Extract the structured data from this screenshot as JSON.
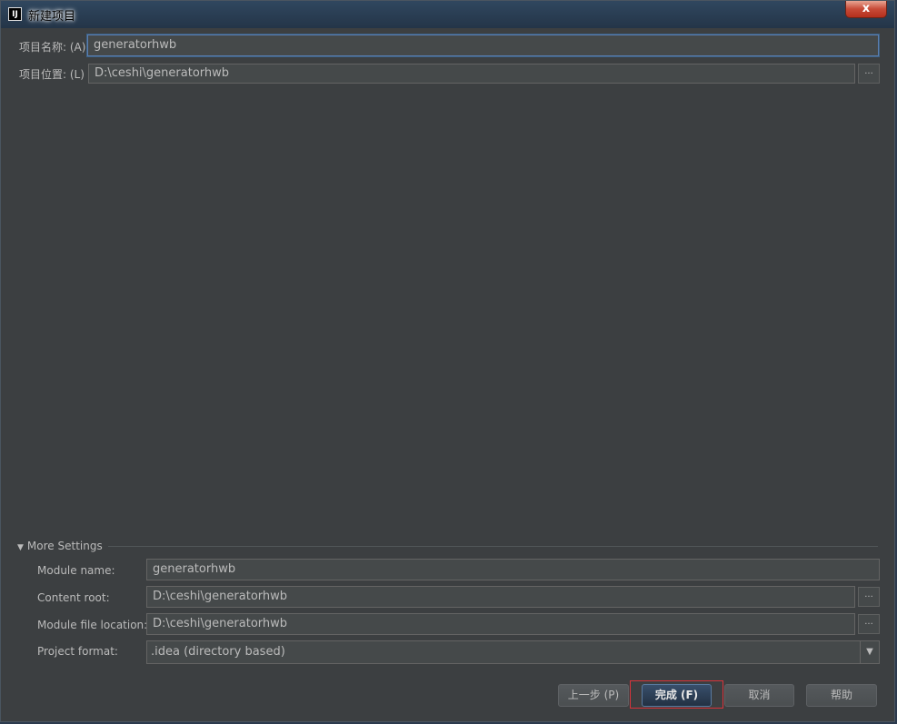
{
  "window": {
    "title": "新建项目",
    "icon_text": "IJ",
    "close_symbol": "x"
  },
  "project": {
    "name_label": "项目名称: (A)",
    "name_value": "generatorhwb",
    "location_label": "项目位置: (L)",
    "location_value": "D:\\ceshi\\generatorhwb",
    "browse_label": "..."
  },
  "more_settings": {
    "toggle_label": "More Settings",
    "module_name_label": "Module name:",
    "module_name_value": "generatorhwb",
    "content_root_label": "Content root:",
    "content_root_value": "D:\\ceshi\\generatorhwb",
    "module_file_label": "Module file location:",
    "module_file_value": "D:\\ceshi\\generatorhwb",
    "project_format_label": "Project format:",
    "project_format_value": ".idea (directory based)"
  },
  "footer": {
    "previous_label": "上一步 (P)",
    "finish_label": "完成 (F)",
    "cancel_label": "取消",
    "help_label": "帮助"
  },
  "colors": {
    "background": "#3c3f41",
    "field": "#45494a",
    "accent_border": "#d9333a"
  }
}
